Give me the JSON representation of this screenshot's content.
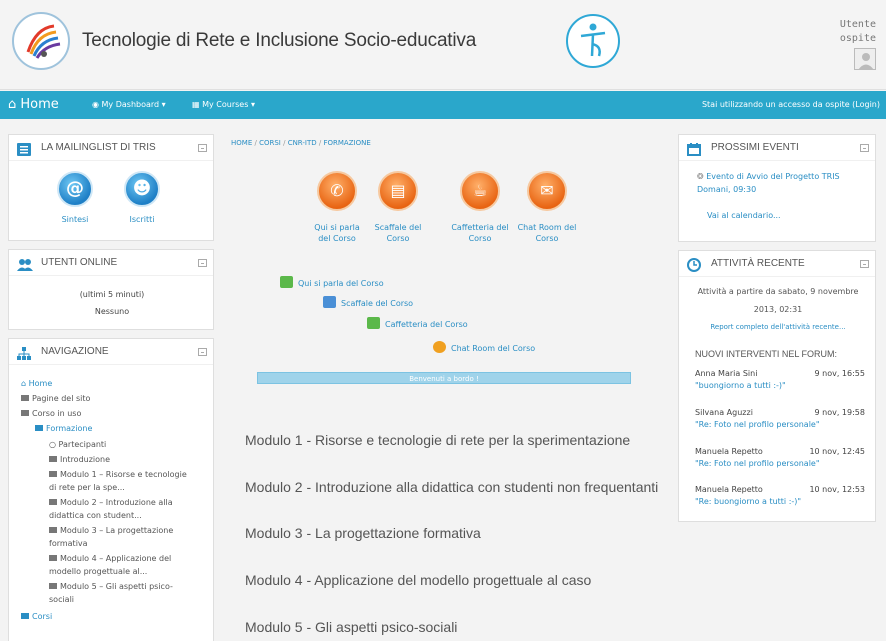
{
  "header": {
    "title": "Tecnologie di Rete e Inclusione Socio-educativa",
    "user_line1": "Utente",
    "user_line2": "ospite"
  },
  "navbar": {
    "home": "Home",
    "dashboard": "My Dashboard",
    "courses": "My Courses",
    "guest_notice": "Stai utilizzando un accesso da ospite (Login)"
  },
  "mailinglist": {
    "title": "LA MAILINGLIST DI TRIS",
    "items": [
      {
        "label": "Sintesi",
        "icon": "at-icon"
      },
      {
        "label": "Iscritti",
        "icon": "users-icon"
      }
    ]
  },
  "online": {
    "title": "UTENTI ONLINE",
    "period": "(ultimi 5 minuti)",
    "none": "Nessuno"
  },
  "navigation": {
    "title": "NAVIGAZIONE",
    "home": "Home",
    "site_pages": "Pagine del sito",
    "current_course": "Corso in uso",
    "course": "Formazione",
    "participants": "Partecipanti",
    "items": [
      "Introduzione",
      "Modulo 1 – Risorse e tecnologie",
      "di rete per la spe...",
      "Modulo 2 – Introduzione alla",
      "didattica con student...",
      "Modulo 3 – La progettazione",
      "formativa",
      "Modulo 4 – Applicazione del",
      "modello progettuale al...",
      "Modulo 5 – Gli aspetti psico-",
      "sociali"
    ],
    "more": "Corsi"
  },
  "breadcrumb": [
    "HOME",
    "CORSI",
    "CNR-ITD",
    "FORMAZIONE"
  ],
  "main": {
    "big_icons": [
      {
        "label": "Qui si parla del Corso",
        "icon": "megaphone-icon"
      },
      {
        "label": "Scaffale del Corso",
        "icon": "book-icon"
      },
      {
        "label": "Caffetteria del Corso",
        "icon": "coffee-icon"
      },
      {
        "label": "Chat Room del Corso",
        "icon": "chat-icon"
      }
    ],
    "activities": [
      {
        "label": "Qui si parla del Corso",
        "icon": "forum-icon",
        "color": "#5bb84a"
      },
      {
        "label": "Scaffale del Corso",
        "icon": "folder-icon",
        "color": "#4a8fd6"
      },
      {
        "label": "Caffetteria del Corso",
        "icon": "forum-icon",
        "color": "#5bb84a"
      },
      {
        "label": "Chat Room del Corso",
        "icon": "chat-icon",
        "color": "#f0a020"
      }
    ],
    "welcome": "Benvenuti a bordo !",
    "modules": [
      "Modulo 1 - Risorse e tecnologie di rete per la sperimentazione",
      "Modulo 2 - Introduzione alla didattica con studenti non frequentanti",
      "Modulo 3 - La progettazione formativa",
      "Modulo 4 - Applicazione del modello progettuale al caso",
      "Modulo 5 - Gli aspetti psico-sociali"
    ]
  },
  "events": {
    "title": "PROSSIMI EVENTI",
    "event_line1": "Evento di Avvio del Progetto TRIS",
    "event_line2": "Domani, 09:30",
    "calendar": "Vai al calendario..."
  },
  "recent": {
    "title": "ATTIVITÀ RECENTE",
    "since_line1": "Attività a partire da sabato, 9 novembre",
    "since_line2": "2013, 02:31",
    "report": "Report completo dell'attività recente...",
    "forum_title": "NUOVI INTERVENTI NEL FORUM:",
    "posts": [
      {
        "author": "Anna Maria Sini",
        "date": "9 nov, 16:55",
        "subject": "\"buongiorno a tutti :-)\""
      },
      {
        "author": "Silvana Aguzzi",
        "date": "9 nov, 19:58",
        "subject": "\"Re: Foto nel profilo personale\""
      },
      {
        "author": "Manuela Repetto",
        "date": "10 nov, 12:45",
        "subject": "\"Re: Foto nel profilo personale\""
      },
      {
        "author": "Manuela Repetto",
        "date": "10 nov, 12:53",
        "subject": "\"Re: buongiorno a tutti :-)\""
      }
    ]
  },
  "colors": {
    "navbar": "#2aa7cb",
    "link": "#2a8ec4",
    "accent_orange": "#e86412"
  }
}
